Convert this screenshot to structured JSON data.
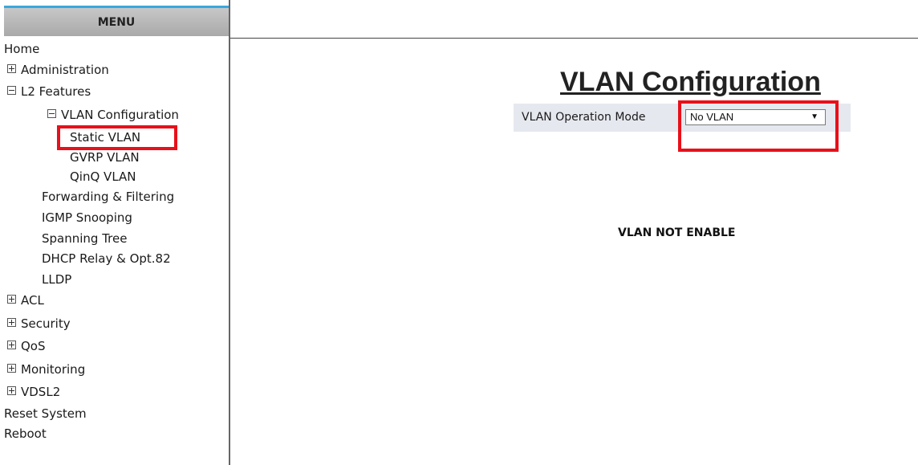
{
  "sidebar": {
    "header": "MENU",
    "items": [
      {
        "label": "Home",
        "toggle": ""
      },
      {
        "label": "Administration",
        "toggle": "plus"
      },
      {
        "label": "L2 Features",
        "toggle": "minus"
      },
      {
        "label": "VLAN Configuration",
        "toggle": "minus"
      },
      {
        "label": "Static VLAN",
        "toggle": ""
      },
      {
        "label": "GVRP VLAN",
        "toggle": ""
      },
      {
        "label": "QinQ VLAN",
        "toggle": ""
      },
      {
        "label": "Forwarding & Filtering",
        "toggle": ""
      },
      {
        "label": "IGMP Snooping",
        "toggle": ""
      },
      {
        "label": "Spanning Tree",
        "toggle": ""
      },
      {
        "label": "DHCP Relay & Opt.82",
        "toggle": ""
      },
      {
        "label": "LLDP",
        "toggle": ""
      },
      {
        "label": "ACL",
        "toggle": "plus"
      },
      {
        "label": "Security",
        "toggle": "plus"
      },
      {
        "label": "QoS",
        "toggle": "plus"
      },
      {
        "label": "Monitoring",
        "toggle": "plus"
      },
      {
        "label": "VDSL2",
        "toggle": "plus"
      },
      {
        "label": "Reset System",
        "toggle": ""
      },
      {
        "label": "Reboot",
        "toggle": ""
      }
    ]
  },
  "main": {
    "title": "VLAN Configuration",
    "mode_label": "VLAN Operation Mode",
    "mode_value": "No VLAN",
    "status": "VLAN NOT ENABLE"
  },
  "colors": {
    "highlight": "#e8101a",
    "menu_header_accent": "#3aa8dd"
  }
}
